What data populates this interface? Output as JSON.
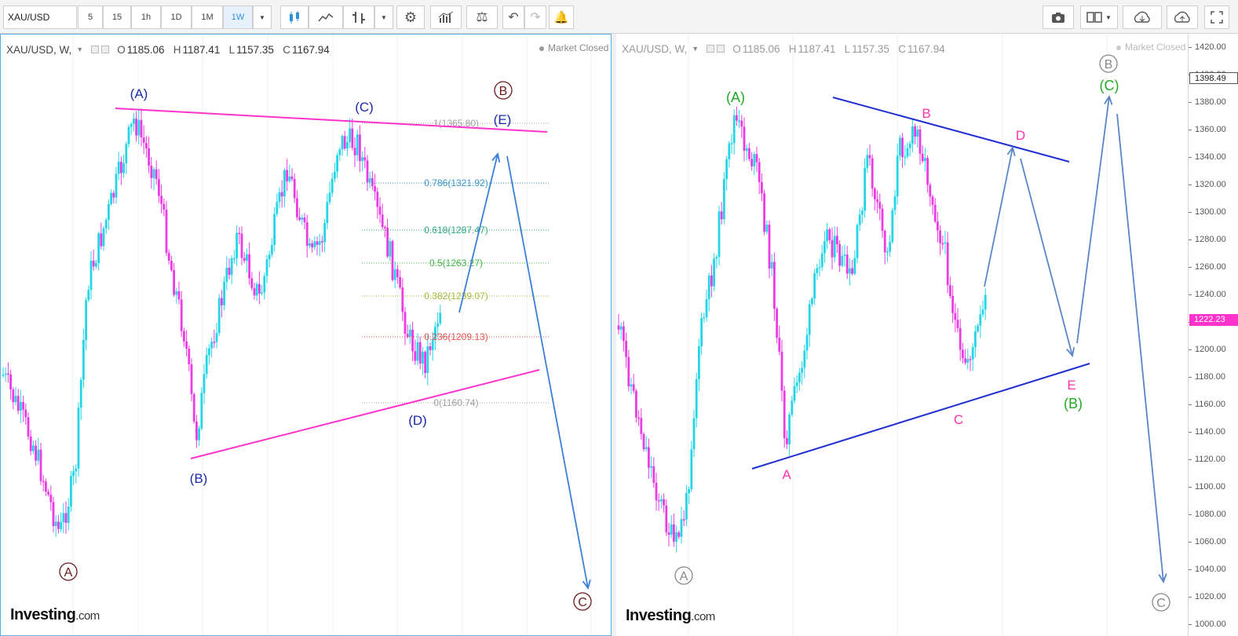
{
  "toolbar": {
    "symbol": "XAU/USD",
    "intervals": [
      "5",
      "15",
      "1h",
      "1D",
      "1M",
      "1W"
    ],
    "active_interval": "1W",
    "accent": "#2f8fd8"
  },
  "left_chart": {
    "symbol": "XAU/USD, W,",
    "ohlc": {
      "open_label": "O",
      "open": "1185.06",
      "high_label": "H",
      "high": "1187.41",
      "low_label": "L",
      "low": "1157.35",
      "close_label": "C",
      "close": "1167.94"
    },
    "status": "Market Closed",
    "logo_main": "Investing",
    "logo_suffix": ".com",
    "wave_labels": {
      "A": "(A)",
      "B": "(B)",
      "C": "(C)",
      "D": "(D)",
      "E": "(E)",
      "circ_A": "A",
      "circ_B": "B",
      "circ_C": "C"
    },
    "fib_levels": [
      {
        "label": "1(1365.80)",
        "price": 1365.8,
        "color": "#9e9e9e"
      },
      {
        "label": "0.786(1321.92)",
        "price": 1321.92,
        "color": "#3a95c9"
      },
      {
        "label": "0.618(1287.47)",
        "price": 1287.47,
        "color": "#2ea77b"
      },
      {
        "label": "0.5(1263.27)",
        "price": 1263.27,
        "color": "#43b549"
      },
      {
        "label": "0.382(1239.07)",
        "price": 1239.07,
        "color": "#a6b83b"
      },
      {
        "label": "0.236(1209.13)",
        "price": 1209.13,
        "color": "#e2524c"
      },
      {
        "label": "0(1160.74)",
        "price": 1160.74,
        "color": "#9e9e9e"
      }
    ],
    "colors": {
      "triangle": "#ff33cc",
      "projection": "#3b7fd8",
      "labels": "#1d2aa8",
      "circle": "#6b1a1a"
    }
  },
  "right_chart": {
    "symbol": "XAU/USD, W,",
    "ohlc": {
      "open_label": "O",
      "open": "1185.06",
      "high_label": "H",
      "high": "1187.41",
      "low_label": "L",
      "low": "1157.35",
      "close_label": "C",
      "close": "1167.94"
    },
    "status": "Market Closed",
    "logo_main": "Investing",
    "logo_suffix": ".com",
    "wave_labels": {
      "A_big": "(A)",
      "B_big": "(B)",
      "C_big": "(C)",
      "a": "A",
      "b": "B",
      "c": "C",
      "d": "D",
      "e": "E",
      "circ_A": "A",
      "circ_B": "B",
      "circ_C": "C"
    },
    "colors": {
      "triangle": "#1f2fd0",
      "sub_labels": "#ff33aa",
      "major_labels": "#22aa22",
      "projection": "#5a86c8",
      "circle": "#888888"
    }
  },
  "price_axis": {
    "ticks": [
      "1420.00",
      "1400.00",
      "1380.00",
      "1360.00",
      "1340.00",
      "1320.00",
      "1300.00",
      "1280.00",
      "1260.00",
      "1240.00",
      "1220.00",
      "1200.00",
      "1180.00",
      "1160.00",
      "1140.00",
      "1120.00",
      "1100.00",
      "1080.00",
      "1060.00",
      "1040.00",
      "1020.00",
      "1000.00"
    ],
    "current_price": "1222.23",
    "current_color": "#ff33cc",
    "marker_price": "1398.49"
  },
  "candle_colors": {
    "up": "#25d5e6",
    "down": "#ea3ce2"
  }
}
